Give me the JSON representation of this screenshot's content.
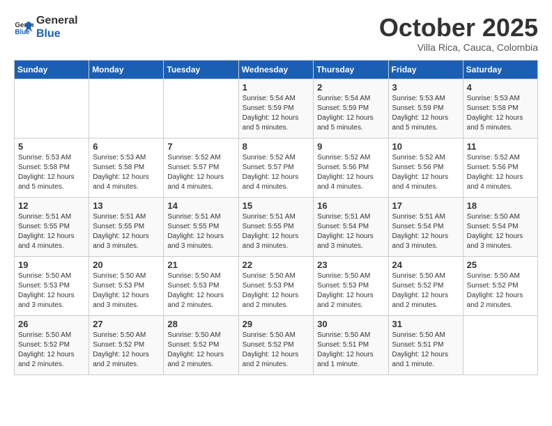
{
  "logo": {
    "text_general": "General",
    "text_blue": "Blue"
  },
  "header": {
    "title": "October 2025",
    "subtitle": "Villa Rica, Cauca, Colombia"
  },
  "days_of_week": [
    "Sunday",
    "Monday",
    "Tuesday",
    "Wednesday",
    "Thursday",
    "Friday",
    "Saturday"
  ],
  "weeks": [
    [
      {
        "day": "",
        "detail": ""
      },
      {
        "day": "",
        "detail": ""
      },
      {
        "day": "",
        "detail": ""
      },
      {
        "day": "1",
        "detail": "Sunrise: 5:54 AM\nSunset: 5:59 PM\nDaylight: 12 hours\nand 5 minutes."
      },
      {
        "day": "2",
        "detail": "Sunrise: 5:54 AM\nSunset: 5:59 PM\nDaylight: 12 hours\nand 5 minutes."
      },
      {
        "day": "3",
        "detail": "Sunrise: 5:53 AM\nSunset: 5:59 PM\nDaylight: 12 hours\nand 5 minutes."
      },
      {
        "day": "4",
        "detail": "Sunrise: 5:53 AM\nSunset: 5:58 PM\nDaylight: 12 hours\nand 5 minutes."
      }
    ],
    [
      {
        "day": "5",
        "detail": "Sunrise: 5:53 AM\nSunset: 5:58 PM\nDaylight: 12 hours\nand 5 minutes."
      },
      {
        "day": "6",
        "detail": "Sunrise: 5:53 AM\nSunset: 5:58 PM\nDaylight: 12 hours\nand 4 minutes."
      },
      {
        "day": "7",
        "detail": "Sunrise: 5:52 AM\nSunset: 5:57 PM\nDaylight: 12 hours\nand 4 minutes."
      },
      {
        "day": "8",
        "detail": "Sunrise: 5:52 AM\nSunset: 5:57 PM\nDaylight: 12 hours\nand 4 minutes."
      },
      {
        "day": "9",
        "detail": "Sunrise: 5:52 AM\nSunset: 5:56 PM\nDaylight: 12 hours\nand 4 minutes."
      },
      {
        "day": "10",
        "detail": "Sunrise: 5:52 AM\nSunset: 5:56 PM\nDaylight: 12 hours\nand 4 minutes."
      },
      {
        "day": "11",
        "detail": "Sunrise: 5:52 AM\nSunset: 5:56 PM\nDaylight: 12 hours\nand 4 minutes."
      }
    ],
    [
      {
        "day": "12",
        "detail": "Sunrise: 5:51 AM\nSunset: 5:55 PM\nDaylight: 12 hours\nand 4 minutes."
      },
      {
        "day": "13",
        "detail": "Sunrise: 5:51 AM\nSunset: 5:55 PM\nDaylight: 12 hours\nand 3 minutes."
      },
      {
        "day": "14",
        "detail": "Sunrise: 5:51 AM\nSunset: 5:55 PM\nDaylight: 12 hours\nand 3 minutes."
      },
      {
        "day": "15",
        "detail": "Sunrise: 5:51 AM\nSunset: 5:55 PM\nDaylight: 12 hours\nand 3 minutes."
      },
      {
        "day": "16",
        "detail": "Sunrise: 5:51 AM\nSunset: 5:54 PM\nDaylight: 12 hours\nand 3 minutes."
      },
      {
        "day": "17",
        "detail": "Sunrise: 5:51 AM\nSunset: 5:54 PM\nDaylight: 12 hours\nand 3 minutes."
      },
      {
        "day": "18",
        "detail": "Sunrise: 5:50 AM\nSunset: 5:54 PM\nDaylight: 12 hours\nand 3 minutes."
      }
    ],
    [
      {
        "day": "19",
        "detail": "Sunrise: 5:50 AM\nSunset: 5:53 PM\nDaylight: 12 hours\nand 3 minutes."
      },
      {
        "day": "20",
        "detail": "Sunrise: 5:50 AM\nSunset: 5:53 PM\nDaylight: 12 hours\nand 3 minutes."
      },
      {
        "day": "21",
        "detail": "Sunrise: 5:50 AM\nSunset: 5:53 PM\nDaylight: 12 hours\nand 2 minutes."
      },
      {
        "day": "22",
        "detail": "Sunrise: 5:50 AM\nSunset: 5:53 PM\nDaylight: 12 hours\nand 2 minutes."
      },
      {
        "day": "23",
        "detail": "Sunrise: 5:50 AM\nSunset: 5:53 PM\nDaylight: 12 hours\nand 2 minutes."
      },
      {
        "day": "24",
        "detail": "Sunrise: 5:50 AM\nSunset: 5:52 PM\nDaylight: 12 hours\nand 2 minutes."
      },
      {
        "day": "25",
        "detail": "Sunrise: 5:50 AM\nSunset: 5:52 PM\nDaylight: 12 hours\nand 2 minutes."
      }
    ],
    [
      {
        "day": "26",
        "detail": "Sunrise: 5:50 AM\nSunset: 5:52 PM\nDaylight: 12 hours\nand 2 minutes."
      },
      {
        "day": "27",
        "detail": "Sunrise: 5:50 AM\nSunset: 5:52 PM\nDaylight: 12 hours\nand 2 minutes."
      },
      {
        "day": "28",
        "detail": "Sunrise: 5:50 AM\nSunset: 5:52 PM\nDaylight: 12 hours\nand 2 minutes."
      },
      {
        "day": "29",
        "detail": "Sunrise: 5:50 AM\nSunset: 5:52 PM\nDaylight: 12 hours\nand 2 minutes."
      },
      {
        "day": "30",
        "detail": "Sunrise: 5:50 AM\nSunset: 5:51 PM\nDaylight: 12 hours\nand 1 minute."
      },
      {
        "day": "31",
        "detail": "Sunrise: 5:50 AM\nSunset: 5:51 PM\nDaylight: 12 hours\nand 1 minute."
      },
      {
        "day": "",
        "detail": ""
      }
    ]
  ]
}
